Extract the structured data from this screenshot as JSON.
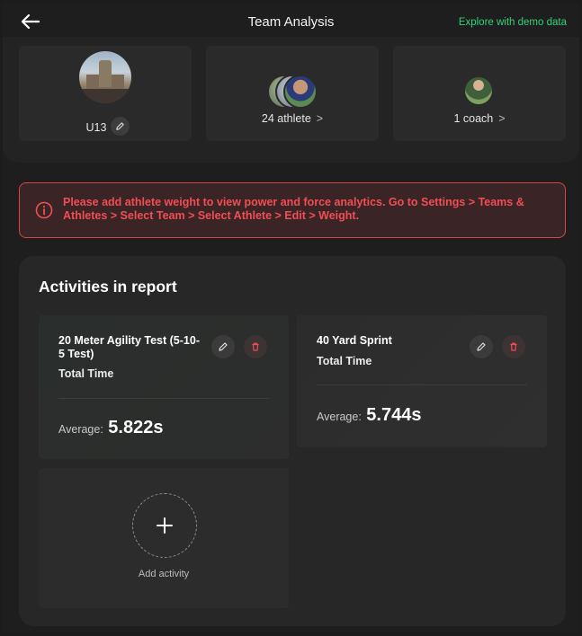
{
  "header": {
    "title": "Team Analysis",
    "demo_link": "Explore with demo data"
  },
  "team": {
    "name": "U13",
    "athletes_label": "24 athlete",
    "coaches_label": "1 coach"
  },
  "alert": {
    "message": "Please add athlete weight to view power and force analytics. Go to Settings > Teams & Athletes > Select Team > Select Athlete > Edit > Weight."
  },
  "activities": {
    "title": "Activities in report",
    "average_label": "Average:",
    "items": [
      {
        "name": "20 Meter Agility Test (5-10-5 Test)",
        "metric": "Total Time",
        "average": "5.822s"
      },
      {
        "name": "40 Yard Sprint",
        "metric": "Total Time",
        "average": "5.744s"
      }
    ],
    "add_label": "Add activity"
  },
  "colors": {
    "accent_green": "#34d27b",
    "alert_red": "#f04e54"
  }
}
